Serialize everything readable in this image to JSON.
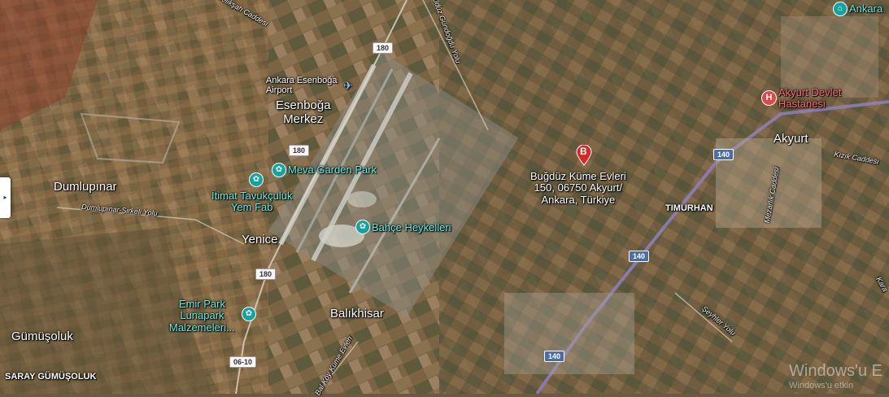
{
  "map": {
    "places": {
      "ankara_top": "Ankara",
      "esenboga_airport": "Ankara Esenboğa\nAirport",
      "esenboga_merkez": "Esenboğa\nMerkez",
      "meva": "Meva Garden Park",
      "itimat": "İtimat Tavukçuluk\nYem Fab",
      "dumlupinar": "Dumlupınar",
      "dumlupinar_road": "Dumlupınar-Sirkeli Yolu",
      "yenice": "Yenice",
      "bahce": "Bahçe Heykelleri",
      "bugduz": "Buğdüz Küme Evleri\n150, 06750 Akyurt/\nAnkara, Türkiye",
      "timurhan": "TIMURHAN",
      "akyurt": "Akyurt",
      "akyurt_hospital": "Akyurt Devlet\nHastanesi",
      "kizik": "Kızık Caddesi",
      "mezarlik": "Mezarlık Caddesi",
      "balikhisar": "Balıkhisar",
      "emir_park": "Emir Park\nLunapark\nMalzemeleri...",
      "gumusoluk": "Gümüşoluk",
      "saray_gumusoluk": "SARAY GÜMÜŞOLUK",
      "seyhler": "Şeyhler Yolu",
      "melikşah": "Melikşah Caddesi",
      "gundogdu": "Güdüz Gündoğdu Yolu",
      "kume_evleri_road": "Bal Köy Küme Evleri",
      "kara": "Kara"
    },
    "shields": {
      "s180a": "180",
      "s180b": "180",
      "s180c": "180",
      "s140a": "140",
      "s140b": "140",
      "s140c": "140",
      "s0610": "06-10"
    },
    "marker_label": "B",
    "watermark": {
      "line1": "Windows'u E",
      "line2": "Windows'u etkin"
    },
    "icons": {
      "park": "park-icon",
      "hospital": "hospital-icon",
      "airport": "airport-icon",
      "museum": "museum-icon"
    }
  }
}
